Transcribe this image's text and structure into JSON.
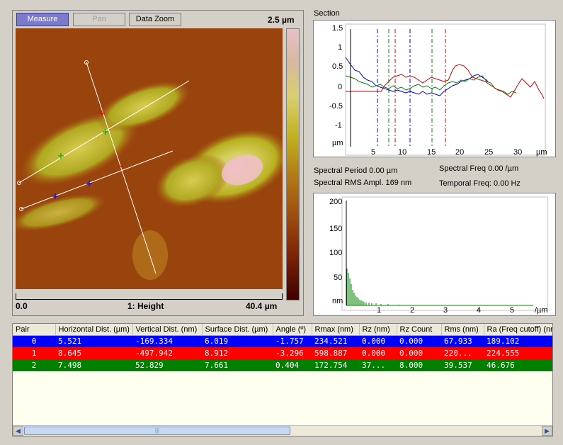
{
  "toolbar": {
    "measure": "Measure",
    "pan": "Pan",
    "data_zoom": "Data Zoom"
  },
  "image_panel": {
    "scale_max": "2.5 µm",
    "x_start": "0.0",
    "channel": "1: Height",
    "x_end": "40.4 µm"
  },
  "section": {
    "title": "Section",
    "y_ticks": [
      "1.5",
      "1",
      "0.5",
      "0",
      "-0.5",
      "-1"
    ],
    "y_unit": "µm",
    "x_ticks": [
      "5",
      "10",
      "15",
      "20",
      "25",
      "30"
    ],
    "x_unit": "µm",
    "colors": {
      "blue": "#0000cc",
      "green": "#008000",
      "red": "#cc0000"
    }
  },
  "spectral": {
    "period": "Spectral Period 0.00 µm",
    "rms": "Spectral RMS Ampl. 169 nm",
    "freq": "Spectral Freq 0.00 /µm",
    "temporal": "Temporal Freq: 0.00 Hz"
  },
  "spectrum": {
    "y_ticks": [
      "200",
      "150",
      "100",
      "50"
    ],
    "y_unit": "nm",
    "x_ticks": [
      "1",
      "2",
      "3",
      "4",
      "5"
    ],
    "x_unit": "/µm"
  },
  "table": {
    "headers": [
      "Pair",
      "Horizontal Dist. (µm)",
      "Vertical Dist. (nm)",
      "Surface Dist. (µm)",
      "Angle (º)",
      "Rmax (nm)",
      "Rz  (nm)",
      "Rz Count",
      "Rms (nm)",
      "Ra (Freq cutoff) (nm)"
    ],
    "rows": [
      {
        "color": "#0000ff",
        "cells": [
          "0",
          "5.521",
          "-169.334",
          "6.019",
          "-1.757",
          "234.521",
          "0.000",
          "0.000",
          "67.933",
          "189.102"
        ]
      },
      {
        "color": "#ff0000",
        "cells": [
          "1",
          "8.645",
          "-497.942",
          "8.912",
          "-3.296",
          "598.887",
          "0.000",
          "0.000",
          "220...",
          "224.555"
        ]
      },
      {
        "color": "#008000",
        "cells": [
          "2",
          "7.498",
          "52.829",
          "7.661",
          "0.404",
          "172.754",
          "37...",
          "8.000",
          "39.537",
          "46.676"
        ]
      }
    ]
  }
}
